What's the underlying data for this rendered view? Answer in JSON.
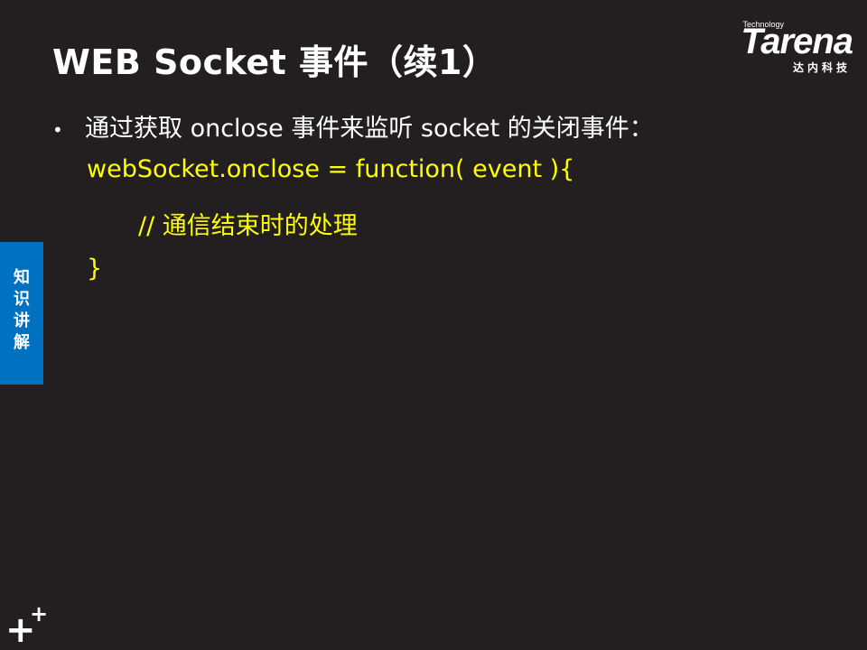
{
  "slide": {
    "title": "WEB Socket 事件（续1）",
    "logo": {
      "tagline": "Technology",
      "brand": "Tarena",
      "chinese": "达内科技"
    },
    "bullet": {
      "marker": "•",
      "text": "通过获取 onclose 事件来监听 socket 的关闭事件："
    },
    "code_lines": [
      "webSocket.onclose = function( event ){",
      "// 通信结束时的处理",
      "}"
    ],
    "side_tab": {
      "chars": [
        "知",
        "识",
        "讲",
        "解"
      ]
    },
    "corner_icon": {
      "big": "+",
      "small": "+"
    }
  }
}
